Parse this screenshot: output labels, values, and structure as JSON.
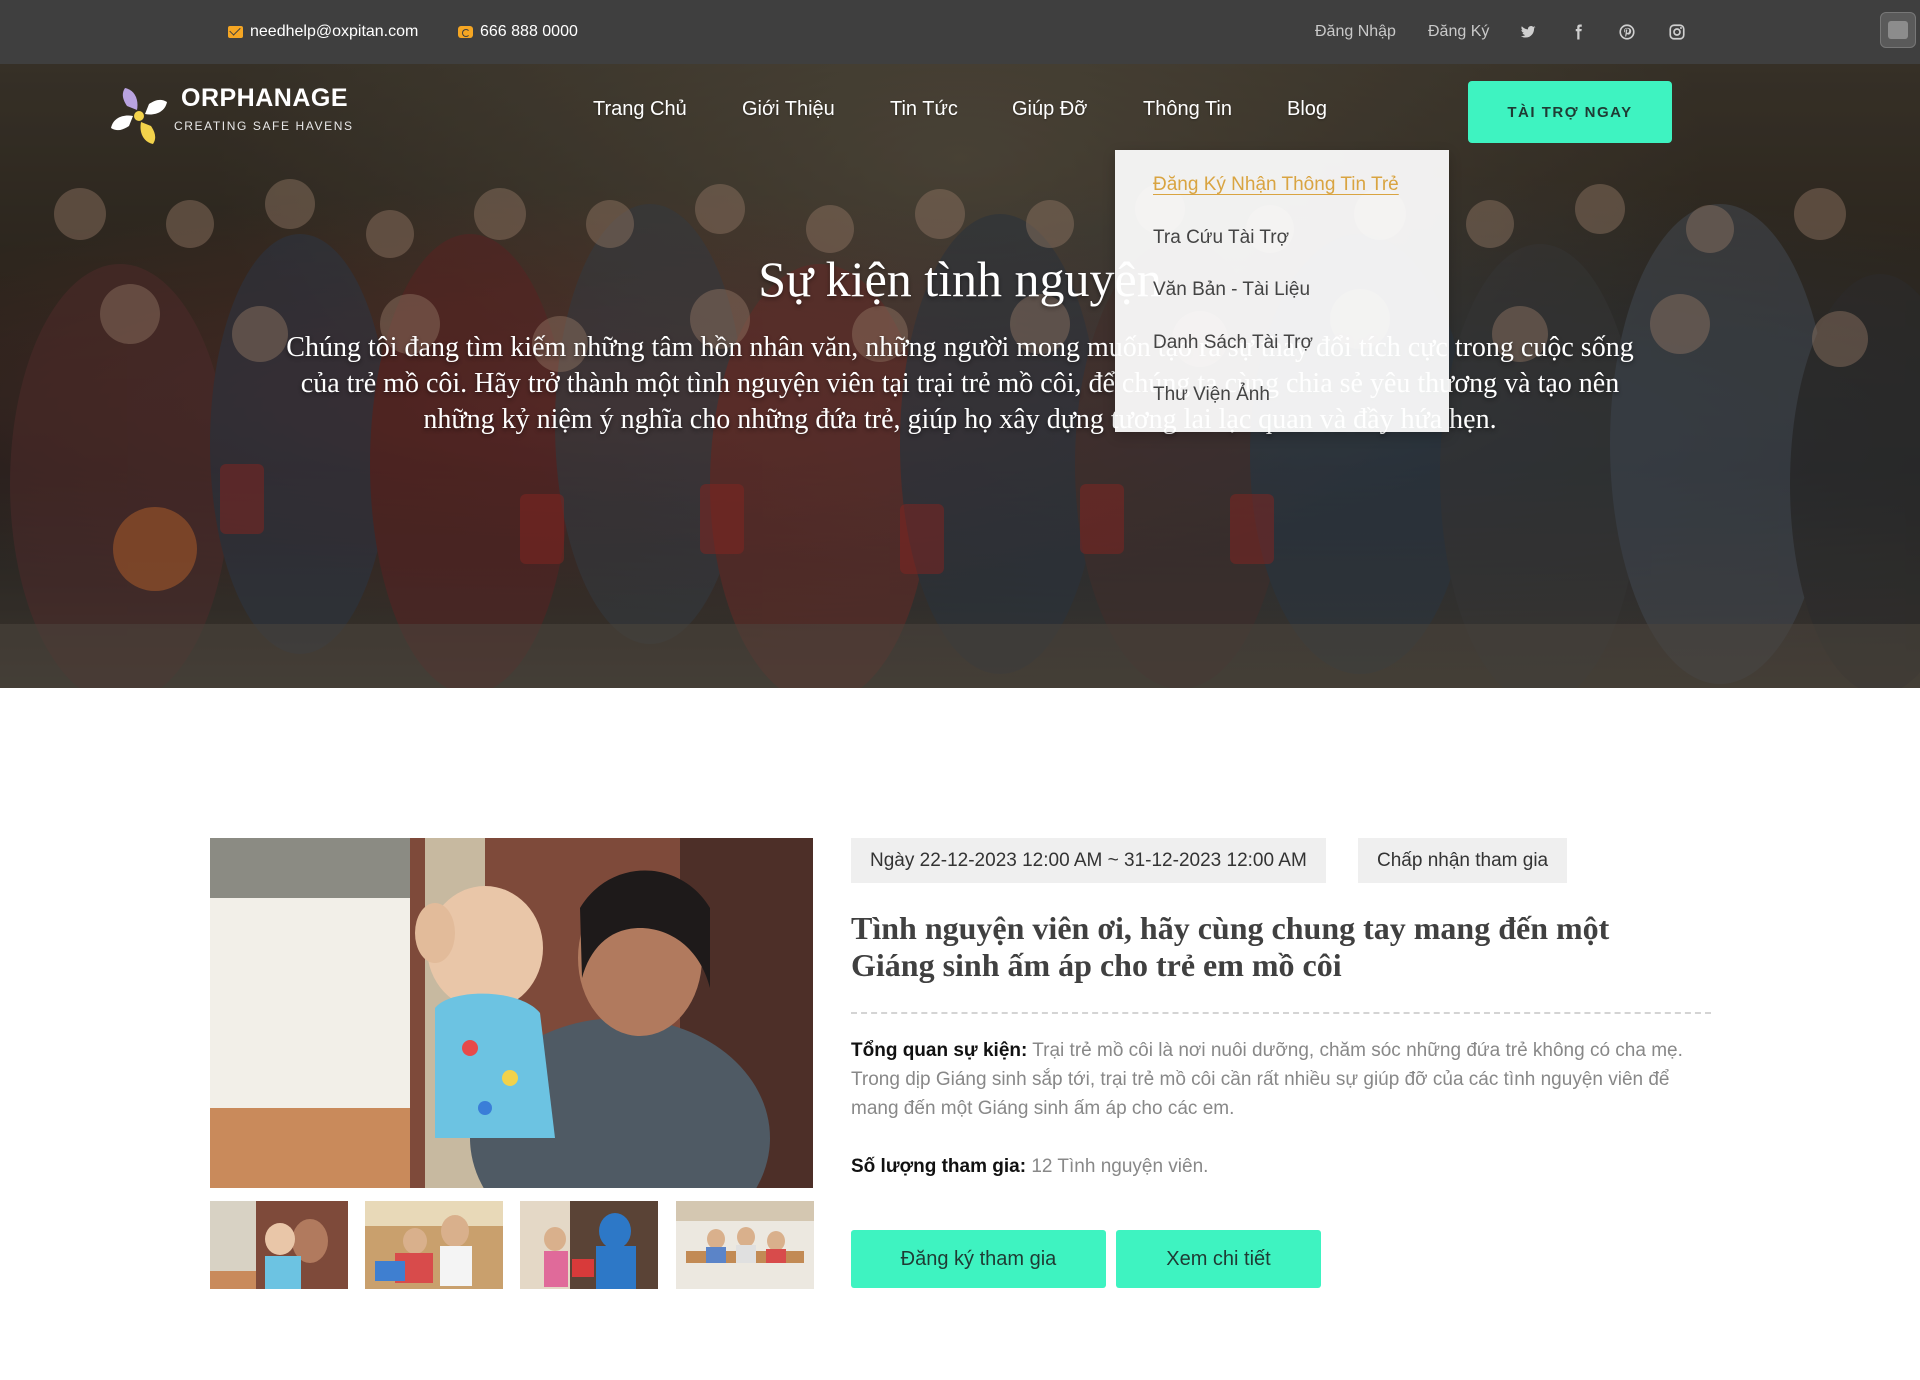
{
  "topbar": {
    "email": "needhelp@oxpitan.com",
    "phone": "666 888 0000",
    "login": "Đăng Nhập",
    "register": "Đăng Ký",
    "social_icons": [
      "twitter-icon",
      "facebook-icon",
      "pinterest-icon",
      "instagram-icon"
    ],
    "icon_color": "#f5a623"
  },
  "logo": {
    "name": "ORPHANAGE",
    "tagline": "CREATING SAFE HAVENS"
  },
  "nav": {
    "items": [
      {
        "label": "Trang Chủ"
      },
      {
        "label": "Giới Thiệu"
      },
      {
        "label": "Tin Tức"
      },
      {
        "label": "Giúp Đỡ"
      },
      {
        "label": "Thông Tin"
      },
      {
        "label": "Blog"
      }
    ],
    "cta_label": "TÀI TRỢ NGAY"
  },
  "dropdown": {
    "items": [
      {
        "label": "Đăng Ký Nhận Thông Tin Trẻ",
        "active": true
      },
      {
        "label": "Tra Cứu Tài Trợ"
      },
      {
        "label": "Văn Bản - Tài Liệu"
      },
      {
        "label": "Danh Sách Tài Trợ"
      },
      {
        "label": "Thư Viện Ảnh"
      }
    ],
    "active_color": "#d9a441"
  },
  "hero": {
    "title": "Sự kiện tình nguyện",
    "description": "Chúng tôi đang tìm kiếm những tâm hồn nhân văn, những người mong muốn tạo ra sự thay đổi tích cực trong cuộc sống của trẻ mồ côi. Hãy trở thành một tình nguyện viên tại trại trẻ mồ côi, để chúng ta cùng chia sẻ yêu thương và tạo nên những kỷ niệm ý nghĩa cho những đứa trẻ, giúp họ xây dựng tương lai lạc quan và đầy hứa hẹn."
  },
  "event": {
    "date_range": "Ngày 22-12-2023 12:00 AM ~ 31-12-2023 12:00 AM",
    "status": "Chấp nhận tham gia",
    "title": "Tình nguyện viên ơi, hãy cùng chung tay mang đến một Giáng sinh ấm áp cho trẻ em mồ côi",
    "overview_label": "Tổng quan sự kiện:",
    "overview_text": "Trại trẻ mồ côi là nơi nuôi dưỡng, chăm sóc những đứa trẻ không có cha mẹ. Trong dịp Giáng sinh sắp tới, trại trẻ mồ côi cần rất nhiều sự giúp đỡ của các tình nguyện viên để mang đến một Giáng sinh ấm áp cho các em.",
    "participants_label": "Số lượng tham gia:",
    "participants_text": "12 Tình nguyện viên.",
    "register_button": "Đăng ký tham gia",
    "details_button": "Xem chi tiết",
    "accent_color": "#3ef3c1"
  }
}
